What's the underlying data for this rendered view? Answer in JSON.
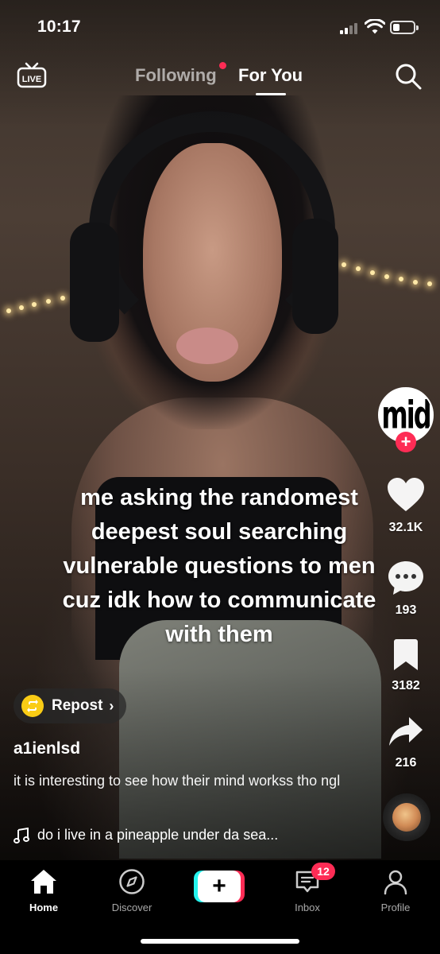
{
  "status_bar": {
    "time": "10:17",
    "battery_level": 0.35
  },
  "top_nav": {
    "live_label": "LIVE",
    "tabs": [
      {
        "label": "Following",
        "active": false,
        "has_dot": true
      },
      {
        "label": "For You",
        "active": true
      }
    ]
  },
  "video": {
    "caption": "me asking the randomest deepest soul searching vulnerable questions to men cuz idk how to communicate with them"
  },
  "right_rail": {
    "creator_avatar_text": "mid",
    "follow_icon": "plus-icon",
    "like": {
      "icon": "heart-icon",
      "count": "32.1K"
    },
    "comment": {
      "icon": "comment-icon",
      "count": "193"
    },
    "bookmark": {
      "icon": "bookmark-icon",
      "count": "3182"
    },
    "share": {
      "icon": "share-icon",
      "count": "216"
    },
    "music_disc_icon": "music-disc-icon"
  },
  "post_info": {
    "repost_label": "Repost",
    "username": "a1ienlsd",
    "description": "it is interesting to see how their mind workss tho ngl",
    "music_title": "do i live in a pineapple under da sea..."
  },
  "bottom_nav": {
    "items": [
      {
        "label": "Home",
        "icon": "home-icon",
        "active": true
      },
      {
        "label": "Discover",
        "icon": "compass-icon",
        "active": false
      },
      {
        "label": "",
        "icon": "create-plus-icon",
        "active": false
      },
      {
        "label": "Inbox",
        "icon": "inbox-icon",
        "active": false,
        "badge": "12"
      },
      {
        "label": "Profile",
        "icon": "profile-icon",
        "active": false
      }
    ]
  },
  "colors": {
    "accent": "#fe2c55",
    "cyan": "#25f4ee",
    "repost_yellow": "#facc15"
  }
}
